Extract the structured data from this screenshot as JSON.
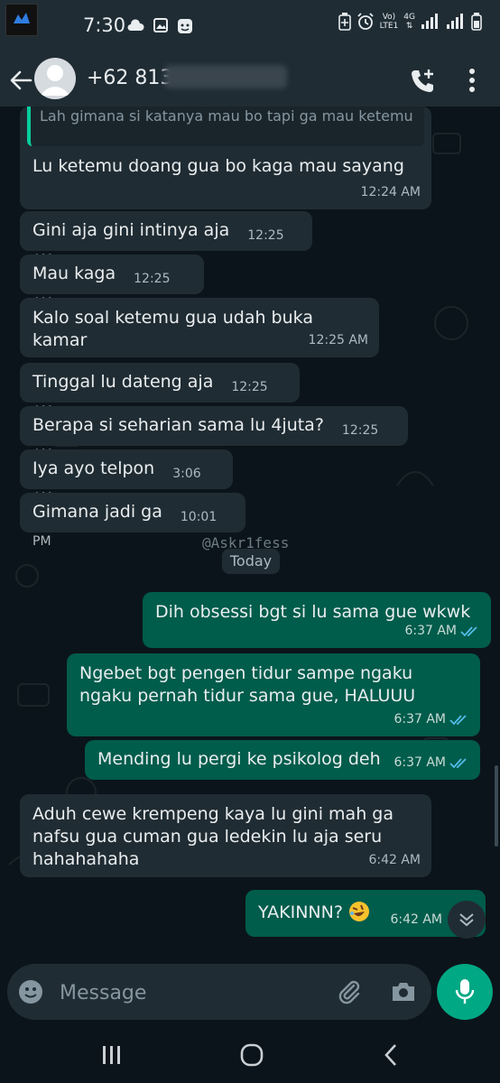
{
  "status_bar": {
    "time": "7:30",
    "network": [
      "Vo)",
      "LTE1"
    ],
    "network_type": "4G",
    "icons": [
      "app-icon",
      "cloud-icon",
      "image-icon",
      "notification-icon",
      "battery-saver-icon",
      "alarm-icon",
      "signal-icon",
      "battery-icon"
    ]
  },
  "header": {
    "contact": "+62 813-",
    "icons": [
      "back-arrow-icon",
      "avatar",
      "add-call-icon",
      "more-vert-icon"
    ]
  },
  "messages": [
    {
      "side": "in",
      "quote": "Lah gimana si katanya mau bo tapi ga mau ketemu",
      "text": "Lu ketemu doang gua bo kaga mau sayang",
      "time": "12:24 AM"
    },
    {
      "side": "in",
      "text": "Gini aja gini intinya aja",
      "time": "12:25 AM"
    },
    {
      "side": "in",
      "text": "Mau kaga",
      "time": "12:25 AM"
    },
    {
      "side": "in",
      "text": "Kalo soal ketemu gua udah buka kamar",
      "time": "12:25 AM"
    },
    {
      "side": "in",
      "text": "Tinggal lu dateng aja",
      "time": "12:25 AM"
    },
    {
      "side": "in",
      "text": "Berapa si seharian sama lu 4juta?",
      "time": "12:25 AM"
    },
    {
      "side": "in",
      "text": "Iya ayo telpon",
      "time": "3:06 AM"
    },
    {
      "side": "in",
      "text": "Gimana jadi ga",
      "time": "10:01 PM"
    },
    {
      "side": "out",
      "text": "Dih obsessi bgt si lu sama gue wkwk",
      "time": "6:37 AM",
      "status": "read"
    },
    {
      "side": "out",
      "text": "Ngebet bgt pengen tidur sampe ngaku ngaku pernah tidur sama gue, HALUUU",
      "time": "6:37 AM",
      "status": "read"
    },
    {
      "side": "out",
      "text": "Mending lu pergi ke psikolog deh",
      "time": "6:37 AM",
      "status": "read"
    },
    {
      "side": "in",
      "text": "Aduh cewe krempeng kaya lu gini mah ga nafsu gua cuman gua ledekin lu aja seru hahahahaha",
      "time": "6:42 AM"
    },
    {
      "side": "out",
      "text": "YAKINNN?",
      "time": "6:42 AM",
      "emoji": "rolling-laughing-emoji"
    }
  ],
  "watermark": "@Askr1fess",
  "day_separator": "Today",
  "composer": {
    "placeholder": "Message",
    "icons": [
      "emoji-icon",
      "attach-icon",
      "camera-icon",
      "mic-icon"
    ]
  },
  "navbar": {
    "icons": [
      "recent-apps-icon",
      "home-icon",
      "back-icon"
    ]
  },
  "colors": {
    "incoming_bubble": "#202c33",
    "outgoing_bubble": "#005c4b",
    "accent": "#00a884",
    "read_ticks": "#53bdeb"
  }
}
